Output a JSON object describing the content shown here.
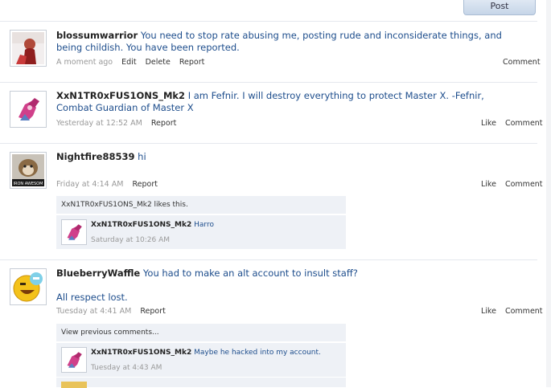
{
  "post_button": "Post",
  "comments": [
    {
      "author": "blossumwarrior",
      "text": "You need to stop rate abusing me, posting rude and inconsiderate things, and being childish. You have been reported.",
      "time": "A moment ago",
      "actions": [
        "Edit",
        "Delete",
        "Report"
      ],
      "right_actions": [
        "Comment"
      ]
    },
    {
      "author": "XxN1TR0xFUS1ONS_Mk2",
      "text": "I am Fefnir. I will destroy everything to protect Master X. -Fefnir, Combat Guardian of Master X",
      "time": "Yesterday at 12:52 AM",
      "actions": [
        "Report"
      ],
      "right_actions": [
        "Like",
        "Comment"
      ]
    },
    {
      "author": "Nightfire88539",
      "text": "hi",
      "time": "Friday at 4:14 AM",
      "actions": [
        "Report"
      ],
      "right_actions": [
        "Like",
        "Comment"
      ],
      "avatar_caption": "IRON AWESOM",
      "likes_text": "XxN1TR0xFUS1ONS_Mk2 likes this.",
      "reply": {
        "author": "XxN1TR0xFUS1ONS_Mk2",
        "text": "Harro",
        "time": "Saturday at 10:26 AM"
      }
    },
    {
      "author": "BlueberryWaffle",
      "text_line1": "You had to make an alt account to insult staff?",
      "text_line2": "All respect lost.",
      "time": "Tuesday at 4:41 AM",
      "actions": [
        "Report"
      ],
      "right_actions": [
        "Like",
        "Comment"
      ],
      "view_previous": "View previous comments...",
      "reply": {
        "author": "XxN1TR0xFUS1ONS_Mk2",
        "text": "Maybe he hacked into my account.",
        "time": "Tuesday at 4:43 AM"
      }
    }
  ]
}
